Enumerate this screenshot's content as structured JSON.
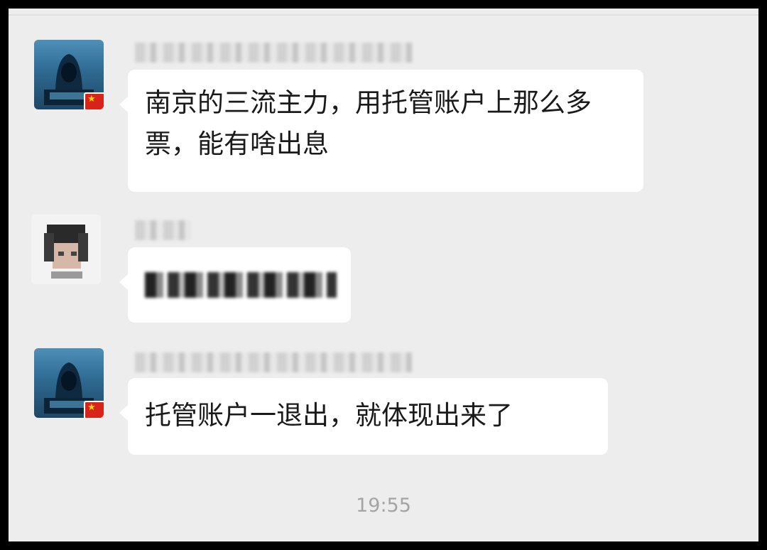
{
  "messages": [
    {
      "sender": "blurred",
      "text": "南京的三流主力，用托管账户上那么多票，能有啥出息"
    },
    {
      "sender": "blurred",
      "text": ""
    },
    {
      "sender": "blurred",
      "text": "托管账户一退出，就体现出来了"
    }
  ],
  "time": "19:55",
  "colors": {
    "background": "#ededed",
    "bubble": "#ffffff",
    "text": "#1a1a1a",
    "time": "#a4a4a4",
    "flag": "#d8231b"
  }
}
